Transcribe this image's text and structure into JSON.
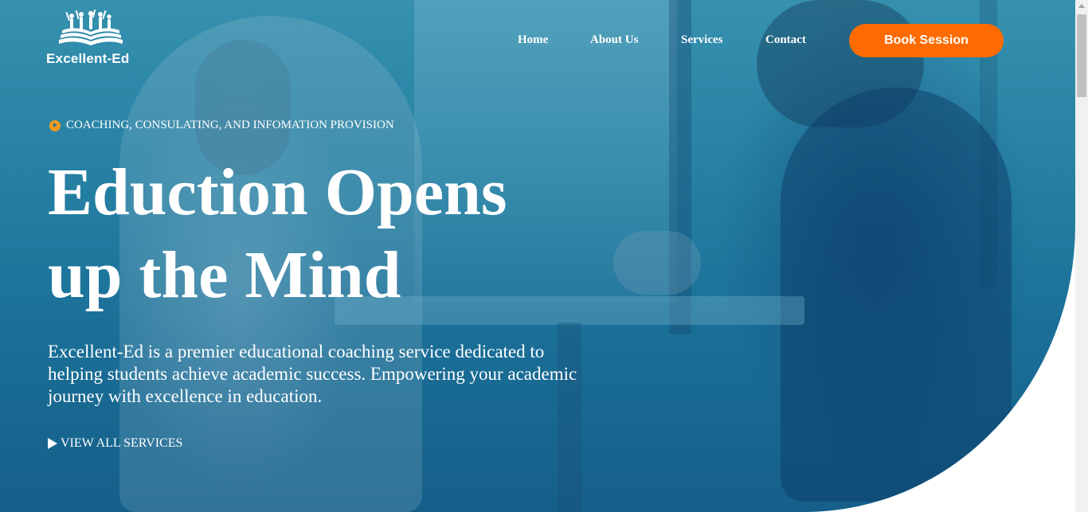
{
  "brand": {
    "name": "Excellent-Ed",
    "logo_icon": "students-on-book-icon"
  },
  "nav": {
    "items": [
      {
        "label": "Home"
      },
      {
        "label": "About Us"
      },
      {
        "label": "Services"
      },
      {
        "label": "Contact"
      }
    ],
    "cta_label": "Book Session"
  },
  "hero": {
    "eyebrow": "COACHING, CONSULATING, AND INFOMATION PROVISION",
    "eyebrow_icon": "play-circle-icon",
    "headline_line1": "Eduction Opens",
    "headline_line2": "up the Mind",
    "description": "Excellent-Ed is a premier educational coaching service dedicated to helping students achieve academic success. Empowering your academic journey with excellence in education.",
    "link_label": "VIEW ALL SERVICES",
    "link_icon": "play-icon"
  },
  "colors": {
    "overlay": "#2580a3",
    "cta": "#ff6b00",
    "accent": "#f39a1c",
    "text": "#ffffff"
  }
}
